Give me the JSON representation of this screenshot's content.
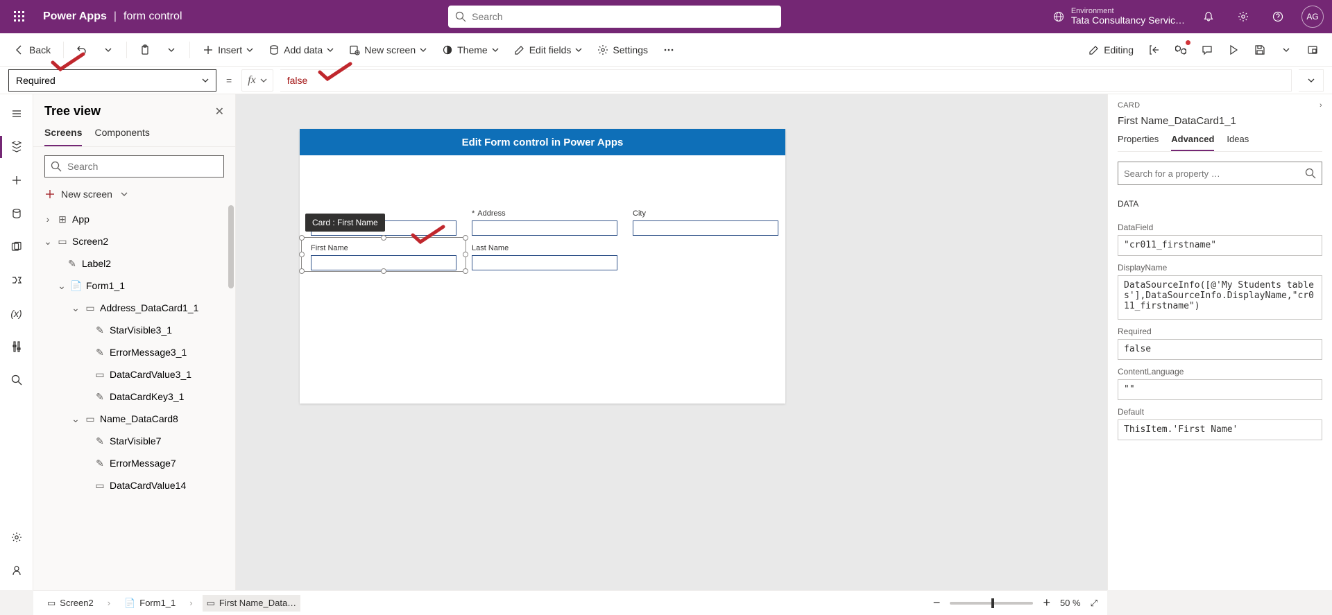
{
  "header": {
    "app": "Power Apps",
    "file": "form control",
    "search_placeholder": "Search",
    "env_label": "Environment",
    "env_name": "Tata Consultancy Servic…",
    "avatar": "AG"
  },
  "cmdbar": {
    "back": "Back",
    "insert": "Insert",
    "add_data": "Add data",
    "new_screen": "New screen",
    "theme": "Theme",
    "edit_fields": "Edit fields",
    "settings": "Settings",
    "editing": "Editing"
  },
  "formula": {
    "property": "Required",
    "fx": "fx",
    "value": "false"
  },
  "tree": {
    "title": "Tree view",
    "tab_screens": "Screens",
    "tab_components": "Components",
    "search_placeholder": "Search",
    "new_screen": "New screen",
    "items": {
      "app": "App",
      "screen2": "Screen2",
      "label2": "Label2",
      "form1": "Form1_1",
      "address_card": "Address_DataCard1_1",
      "starvisible3": "StarVisible3_1",
      "errormsg3": "ErrorMessage3_1",
      "datacardvalue3": "DataCardValue3_1",
      "datacardkey3": "DataCardKey3_1",
      "name_card": "Name_DataCard8",
      "starvisible7": "StarVisible7",
      "errormsg7": "ErrorMessage7",
      "datacardvalue14": "DataCardValue14"
    }
  },
  "canvas": {
    "title": "Edit Form control in Power Apps",
    "tooltip": "Card : First Name",
    "fields": {
      "address_label": "Address",
      "city_label": "City",
      "firstname_label": "First Name",
      "lastname_label": "Last Name"
    }
  },
  "props": {
    "category": "CARD",
    "name": "First Name_DataCard1_1",
    "tab_properties": "Properties",
    "tab_advanced": "Advanced",
    "tab_ideas": "Ideas",
    "search_placeholder": "Search for a property …",
    "section_data": "DATA",
    "datafield_label": "DataField",
    "datafield_value": "\"cr011_firstname\"",
    "displayname_label": "DisplayName",
    "displayname_value": "DataSourceInfo([@'My Students tables'],DataSourceInfo.DisplayName,\"cr011_firstname\")",
    "required_label": "Required",
    "required_value": "false",
    "contentlang_label": "ContentLanguage",
    "contentlang_value": "\"\"",
    "default_label": "Default",
    "default_value": "ThisItem.'First Name'"
  },
  "status": {
    "screen": "Screen2",
    "form": "Form1_1",
    "card": "First Name_Data…",
    "zoom": "50 %"
  }
}
